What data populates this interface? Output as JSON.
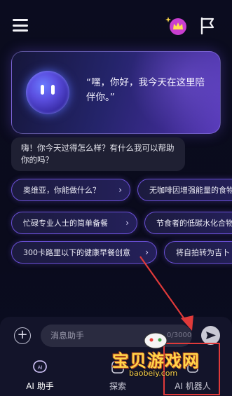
{
  "hero": {
    "greeting": "“嘿，你好，我今天在这里陪伴你。”"
  },
  "chat": {
    "assistant_message": "嗨！你今天过得怎么样？有什么我可以帮助你的吗？"
  },
  "suggestions": [
    "奥维亚，你能做什么？",
    "无咖啡因增强能量的食物",
    "忙碌专业人士的简单备餐",
    "节食者的低碳水化合物",
    "300卡路里以下的健康早餐创意",
    "将自拍转为吉卜"
  ],
  "composer": {
    "placeholder": "消息助手",
    "char_count": "0/3000"
  },
  "tabs": [
    {
      "label": "AI 助手",
      "icon": "ai-bubble-icon",
      "active": true
    },
    {
      "label": "探索",
      "icon": "explore-icon",
      "active": false
    },
    {
      "label": "AI 机器人",
      "icon": "robot-icon",
      "active": false
    }
  ],
  "watermark": {
    "main": "宝贝游戏网",
    "sub": "baobeiy.com"
  },
  "colors": {
    "accent": "#6a4fd6",
    "highlight": "#e03a3a",
    "background": "#0b0c1f"
  }
}
